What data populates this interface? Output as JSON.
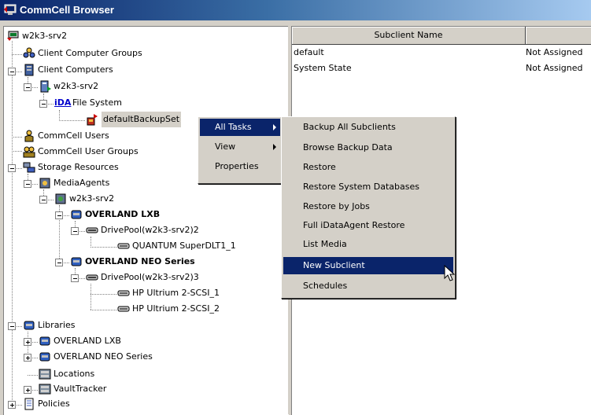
{
  "window": {
    "title": "CommCell Browser"
  },
  "tree": {
    "items": [
      {
        "label": "w2k3-srv2",
        "icon": "commcell-icon"
      },
      {
        "label": "Client Computer Groups",
        "icon": "client-group-icon"
      },
      {
        "label": "Client Computers",
        "icon": "client-computers-icon"
      },
      {
        "label": "w2k3-srv2",
        "icon": "client-computer-icon"
      },
      {
        "label": "File System",
        "icon": "idataagent-icon",
        "prefix": "iDA"
      },
      {
        "label": "defaultBackupSet",
        "icon": "backupset-icon"
      },
      {
        "label": "CommCell Users",
        "icon": "user-icon"
      },
      {
        "label": "CommCell User Groups",
        "icon": "user-groups-icon"
      },
      {
        "label": "Storage Resources",
        "icon": "storage-resources-icon"
      },
      {
        "label": "MediaAgents",
        "icon": "mediaagents-icon"
      },
      {
        "label": "w2k3-srv2",
        "icon": "mediaagent-icon"
      },
      {
        "label": "OVERLAND LXB",
        "icon": "library-icon"
      },
      {
        "label": "DrivePool(w2k3-srv2)2",
        "icon": "drivepool-icon"
      },
      {
        "label": "QUANTUM SuperDLT1_1",
        "icon": "drive-icon"
      },
      {
        "label": "OVERLAND NEO Series",
        "icon": "library-icon"
      },
      {
        "label": "DrivePool(w2k3-srv2)3",
        "icon": "drivepool-icon"
      },
      {
        "label": "HP Ultrium 2-SCSI_1",
        "icon": "drive-icon"
      },
      {
        "label": "HP Ultrium 2-SCSI_2",
        "icon": "drive-icon"
      },
      {
        "label": "Libraries",
        "icon": "libraries-icon"
      },
      {
        "label": "OVERLAND LXB",
        "icon": "library-icon"
      },
      {
        "label": "OVERLAND NEO Series",
        "icon": "library-icon"
      },
      {
        "label": "Locations",
        "icon": "locations-icon"
      },
      {
        "label": "VaultTracker",
        "icon": "vaulttracker-icon"
      },
      {
        "label": "Policies",
        "icon": "policies-icon"
      }
    ]
  },
  "list": {
    "columns": [
      "Subclient Name",
      ""
    ],
    "rows": [
      {
        "name": "default",
        "status": "Not Assigned"
      },
      {
        "name": "System State",
        "status": "Not Assigned"
      }
    ]
  },
  "context_menu": {
    "items": [
      "All Tasks",
      "View",
      "Properties"
    ],
    "selected": "All Tasks"
  },
  "submenu": {
    "items": [
      "Backup All Subclients",
      "Browse Backup Data",
      "Restore",
      "Restore System Databases",
      "Restore by Jobs",
      "Full iDataAgent Restore",
      "List Media",
      "New Subclient",
      "Schedules"
    ],
    "selected": "New Subclient"
  },
  "colors": {
    "title_dark": "#0a246a",
    "title_light": "#a6caf0",
    "selection": "#0a246a",
    "face": "#d4d0c8"
  }
}
